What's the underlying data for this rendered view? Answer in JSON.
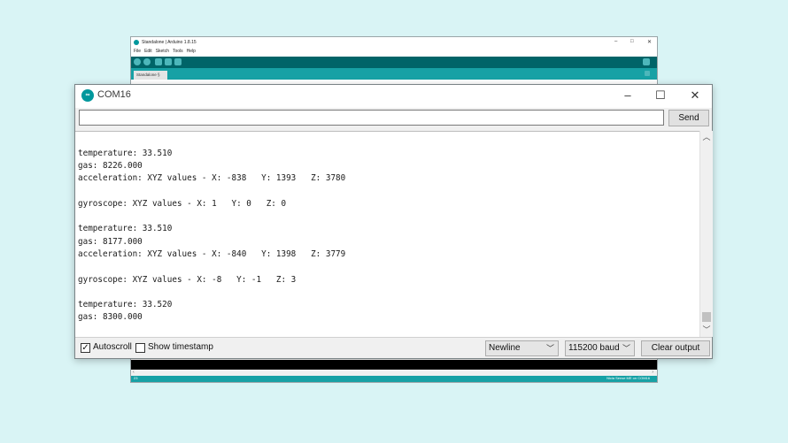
{
  "ide": {
    "title": "Standalone | Arduino 1.8.15",
    "menu": [
      "File",
      "Edit",
      "Sketch",
      "Tools",
      "Help"
    ],
    "tab_label": "Standalone §",
    "status_line": "Nicla Sense ME on COM16",
    "line_number": "23"
  },
  "serial": {
    "title": "COM16",
    "logo_text": "∞",
    "send_input_value": "",
    "send_label": "Send",
    "output_lines": [
      "gyroscope: XYZ values - X: 1   Y: 0   Z: 0",
      "",
      "temperature: 33.510",
      "gas: 8226.000",
      "acceleration: XYZ values - X: -838   Y: 1393   Z: 3780",
      "",
      "gyroscope: XYZ values - X: 1   Y: 0   Z: 0",
      "",
      "temperature: 33.510",
      "gas: 8177.000",
      "acceleration: XYZ values - X: -840   Y: 1398   Z: 3779",
      "",
      "gyroscope: XYZ values - X: -8   Y: -1   Z: 3",
      "",
      "temperature: 33.520",
      "gas: 8300.000"
    ],
    "autoscroll_label": "Autoscroll",
    "autoscroll_checked": true,
    "timestamp_label": "Show timestamp",
    "timestamp_checked": false,
    "line_ending": "Newline",
    "baud_rate": "115200 baud",
    "clear_label": "Clear output"
  },
  "colors": {
    "background": "#d9f4f5",
    "arduino_teal": "#00979c",
    "toolbar_dark_teal": "#006468"
  }
}
